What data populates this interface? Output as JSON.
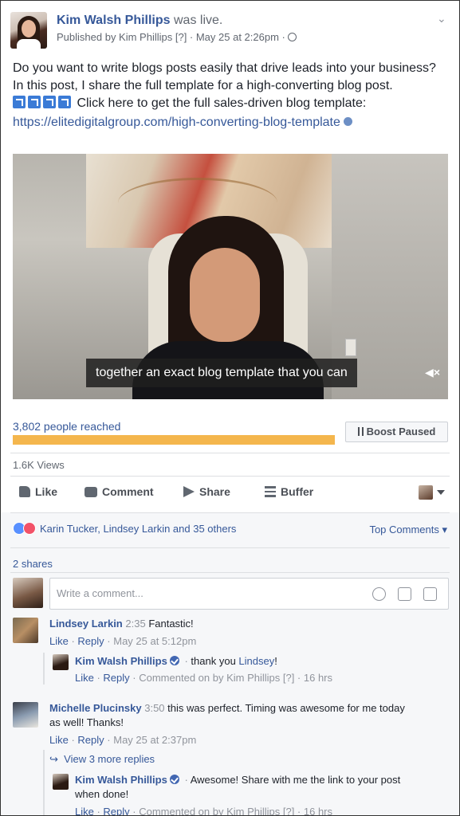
{
  "post": {
    "author": "Kim Walsh Phillips",
    "author_suffix": " was live.",
    "meta": "Published by Kim Phillips [?] · May 25 at 2:26pm ·",
    "text_line1": "Do you want to write blogs posts easily that drive leads into your business?",
    "text_line2": "In this post, I share the full template for a high-converting blog post.",
    "text_line3": " Click here to get the full sales-driven blog template:",
    "link": "https://elitedigitalgroup.com/high-converting-blog-template"
  },
  "video": {
    "caption": "together an exact blog template that you can",
    "mute_label": "◀×"
  },
  "stats": {
    "reach_text": "3,802 people reached",
    "reach_fraction": 1.0,
    "boost_label": "Boost Paused",
    "views": "1.6K Views"
  },
  "actions": {
    "like": "Like",
    "comment": "Comment",
    "share": "Share",
    "buffer": "Buffer"
  },
  "reactions": {
    "summary": "Karin Tucker, Lindsey Larkin and 35 others",
    "sort_label": "Top Comments ▾",
    "shares": "2 shares"
  },
  "composer": {
    "placeholder": "Write a comment..."
  },
  "comments": [
    {
      "name": "Lindsey Larkin",
      "timestamp": "2:35",
      "text": "Fantastic!",
      "meta_like": "Like",
      "meta_reply": "Reply",
      "meta_rest": "May 25 at 5:12pm"
    },
    {
      "name": "Kim Walsh Phillips",
      "text": "thank you ",
      "mention": "Lindsey",
      "text_end": "!",
      "meta_like": "Like",
      "meta_reply": "Reply",
      "meta_rest": "Commented on by Kim Phillips [?] · 16 hrs"
    },
    {
      "name": "Michelle Plucinsky",
      "timestamp": "3:50",
      "text": "this was perfect. Timing was awesome for me today",
      "text2": "as well! Thanks!",
      "meta_like": "Like",
      "meta_reply": "Reply",
      "meta_rest": "May 25 at 2:37pm"
    },
    {
      "name": "Kim Walsh Phillips",
      "text": "Awesome! Share with me the link to your post",
      "text2": "when done!",
      "meta_like": "Like",
      "meta_reply": "Reply",
      "meta_rest": "Commented on by Kim Phillips [?] · 16 hrs"
    }
  ],
  "more_replies": "View 3 more replies"
}
